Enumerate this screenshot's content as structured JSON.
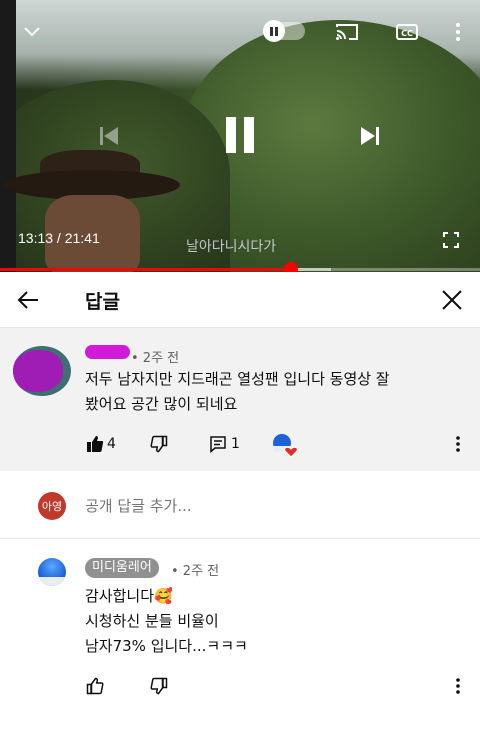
{
  "player": {
    "time_current": "13:13",
    "time_total": "21:41",
    "time_display": "13:13 / 21:41",
    "subtitle": "날아다니시다가",
    "progress": 0.606,
    "buffered": 0.69,
    "state": "playing"
  },
  "header": {
    "title": "답글"
  },
  "comment": {
    "time": "• 2주 전",
    "text_line1": "저두 남자지만 지드래곤 열성팬 입니다 동영상 잘",
    "text_line2": "봤어요 공간 많이 되네요",
    "likes": "4",
    "replies": "1"
  },
  "add_reply": {
    "avatar_text": "아영",
    "placeholder": "공개 답글 추가..."
  },
  "reply": {
    "author": "미디움레어",
    "time": "• 2주 전",
    "line1": "감사합니다🥰",
    "line2": "시청하신 분들 비율이",
    "line3": "남자73% 입니다...ㅋㅋㅋ"
  },
  "colors": {
    "accent_red": "#ff0000",
    "creator_badge": "#909090",
    "highlight_bg": "#f2f2f2"
  },
  "icons": [
    "chevron-down-icon",
    "autoplay-toggle-icon",
    "cast-icon",
    "closed-captions-icon",
    "more-vert-icon",
    "previous-icon",
    "pause-icon",
    "next-icon",
    "fullscreen-icon",
    "back-arrow-icon",
    "close-icon",
    "thumb-up-icon",
    "thumb-down-icon",
    "reply-icon",
    "creator-heart-icon"
  ]
}
